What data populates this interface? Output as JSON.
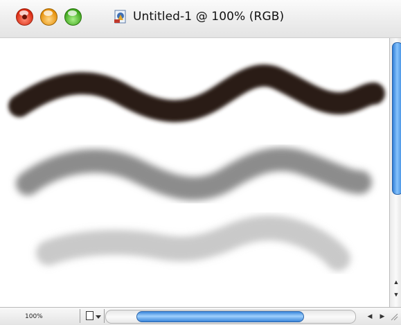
{
  "window": {
    "title": "Untitled-1 @ 100% (RGB)"
  },
  "status": {
    "zoom": "100%"
  },
  "icons": {
    "close": "close-icon",
    "minimize": "minimize-icon",
    "zoom": "zoom-icon",
    "document": "photoshop-document-icon",
    "info": "document-info-icon",
    "scroll_left": "arrow-left-icon",
    "scroll_right": "arrow-right-icon",
    "scroll_up": "arrow-up-icon",
    "scroll_down": "arrow-down-icon",
    "resize": "resize-grip-icon"
  },
  "colors": {
    "stroke_dark": "#2a1a16",
    "stroke_mid": "#8c8c8c",
    "stroke_light": "#c9c9c9",
    "scroll_thumb": "#4a95e6"
  }
}
